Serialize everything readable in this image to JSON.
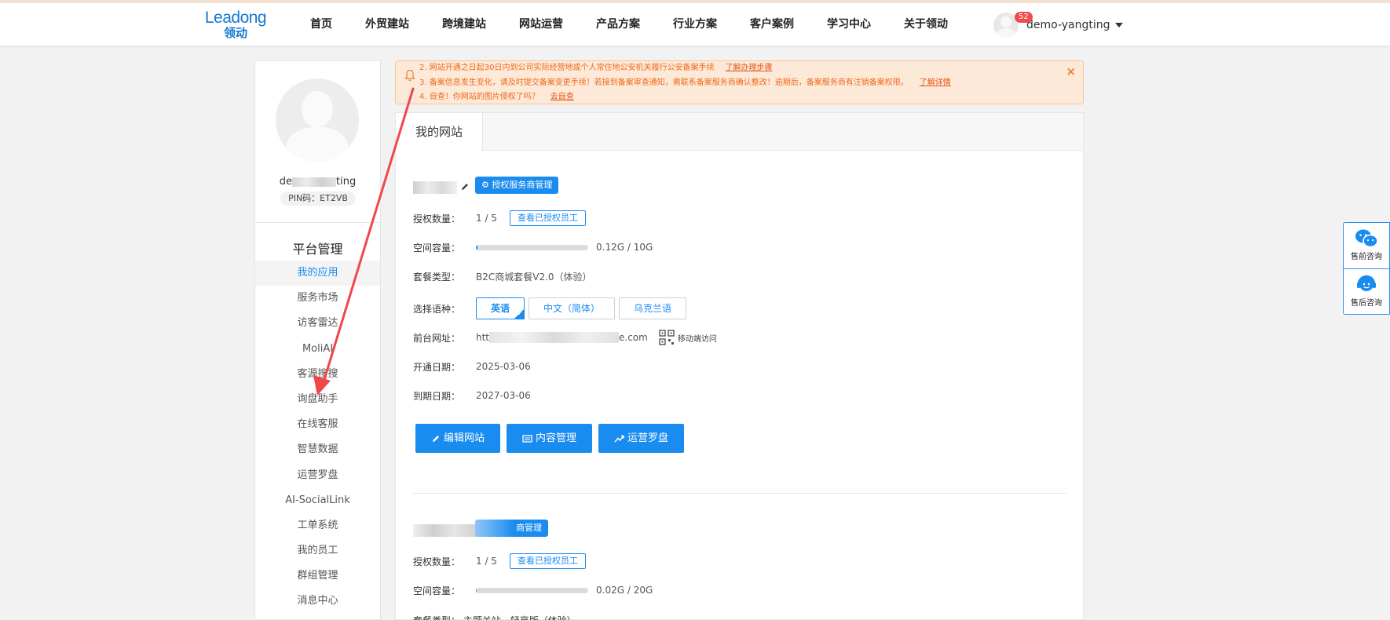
{
  "header": {
    "logo_en": "Leadong",
    "logo_cn": "领动",
    "nav": [
      "首页",
      "外贸建站",
      "跨境建站",
      "网站运营",
      "产品方案",
      "行业方案",
      "客户案例",
      "学习中心",
      "关于领动"
    ],
    "badge_count": "52",
    "username": "demo-yangting"
  },
  "sidebar": {
    "username_prefix": "de",
    "username_suffix": "ting",
    "pin": "PIN码：ET2VB",
    "title": "平台管理",
    "menu": [
      "我的应用",
      "服务市场",
      "访客雷达",
      "MoliAI",
      "客源搜搜",
      "询盘助手",
      "在线客服",
      "智慧数据",
      "运营罗盘",
      "AI-SocialLink",
      "工单系统",
      "我的员工",
      "群组管理",
      "消息中心"
    ],
    "active_index": 0
  },
  "notice": {
    "lines": [
      {
        "text": "2. 网站开通之日起30日内到公司实际经营地或个人常住地公安机关履行公安备案手续",
        "link": "了解办理步骤"
      },
      {
        "text": "3. 备案信息发生变化，请及时提交备案变更手续！若接到备案审查通知，需联系备案服务商确认整改！逾期后，备案服务商有注销备案权限。",
        "link": "了解详情"
      },
      {
        "text": "4. 自查！你网站的图片侵权了吗？",
        "link": "去自查"
      }
    ],
    "close": "×"
  },
  "panel": {
    "tab": "我的网站",
    "site1": {
      "auth_btn": "授权服务商管理",
      "labels": {
        "count": "授权数量：",
        "space": "空间容量：",
        "plan": "套餐类型：",
        "lang": "选择语种：",
        "url": "前台网址：",
        "open": "开通日期：",
        "expire": "到期日期："
      },
      "count": "1 / 5",
      "view_btn": "查看已授权员工",
      "space_used_fraction": 0.012,
      "space_text": "0.12G / 10G",
      "plan": "B2C商城套餐V2.0（体验）",
      "languages": [
        "英语",
        "中文（简体）",
        "乌克兰语"
      ],
      "selected_language": 0,
      "url_prefix": "htt",
      "url_suffix": "e.com",
      "mobile": "移动端访问",
      "open_date": "2025-03-06",
      "expire_date": "2027-03-06",
      "actions": [
        "编辑网站",
        "内容管理",
        "运营罗盘"
      ]
    },
    "site2": {
      "auth_btn": "商管理",
      "count_label": "授权数量：",
      "count": "1 / 5",
      "view_btn": "查看已授权员工",
      "space_label": "空间容量：",
      "space_used_fraction": 0.001,
      "space_text": "0.02G / 20G",
      "plan_partial": "套餐类型：      主题关站 - 轻享版（体验）"
    }
  },
  "float": {
    "presale": "售前咨询",
    "aftersale": "售后咨询"
  },
  "colors": {
    "accent": "#1a8cf0",
    "notice_text": "#ee6a1c",
    "annotation_arrow": "#f0474a"
  }
}
